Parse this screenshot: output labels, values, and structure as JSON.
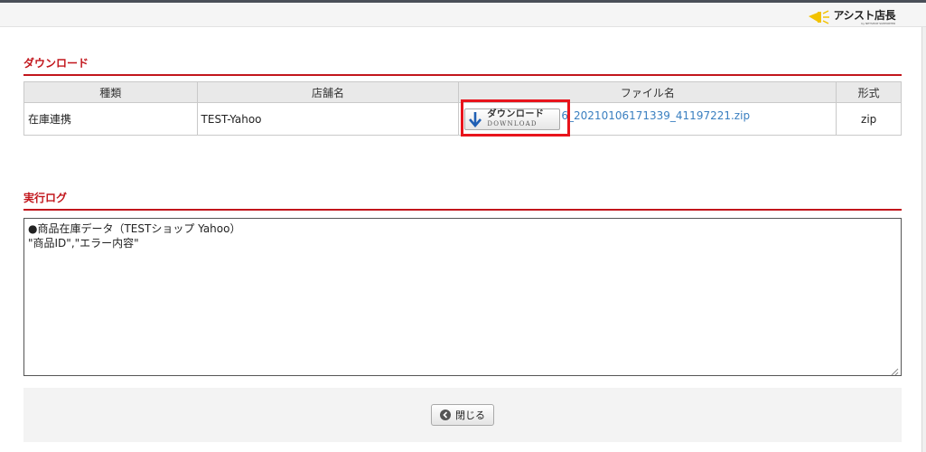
{
  "header": {
    "logo_text": "アシスト店長",
    "logo_subtext": "by NETSHOP SUPPORTER"
  },
  "download_section": {
    "title": "ダウンロード",
    "columns": [
      "種類",
      "店舗名",
      "ファイル名",
      "形式"
    ],
    "rows": [
      {
        "type": "在庫連携",
        "shop": "TEST-Yahoo",
        "button_label_ja": "ダウンロード",
        "button_label_en": "DOWNLOAD",
        "file_name": "6_20210106171339_41197221.zip",
        "format": "zip"
      }
    ]
  },
  "log_section": {
    "title": "実行ログ",
    "lines": [
      "●商品在庫データ（TESTショップ Yahoo）",
      "\"商品ID\",\"エラー内容\""
    ]
  },
  "footer": {
    "close_label": "閉じる"
  },
  "colors": {
    "section_red": "#c2161c",
    "highlight_red": "#e8141c",
    "link_blue": "#3a7fc0",
    "arrow_blue": "#1f5fb4"
  }
}
